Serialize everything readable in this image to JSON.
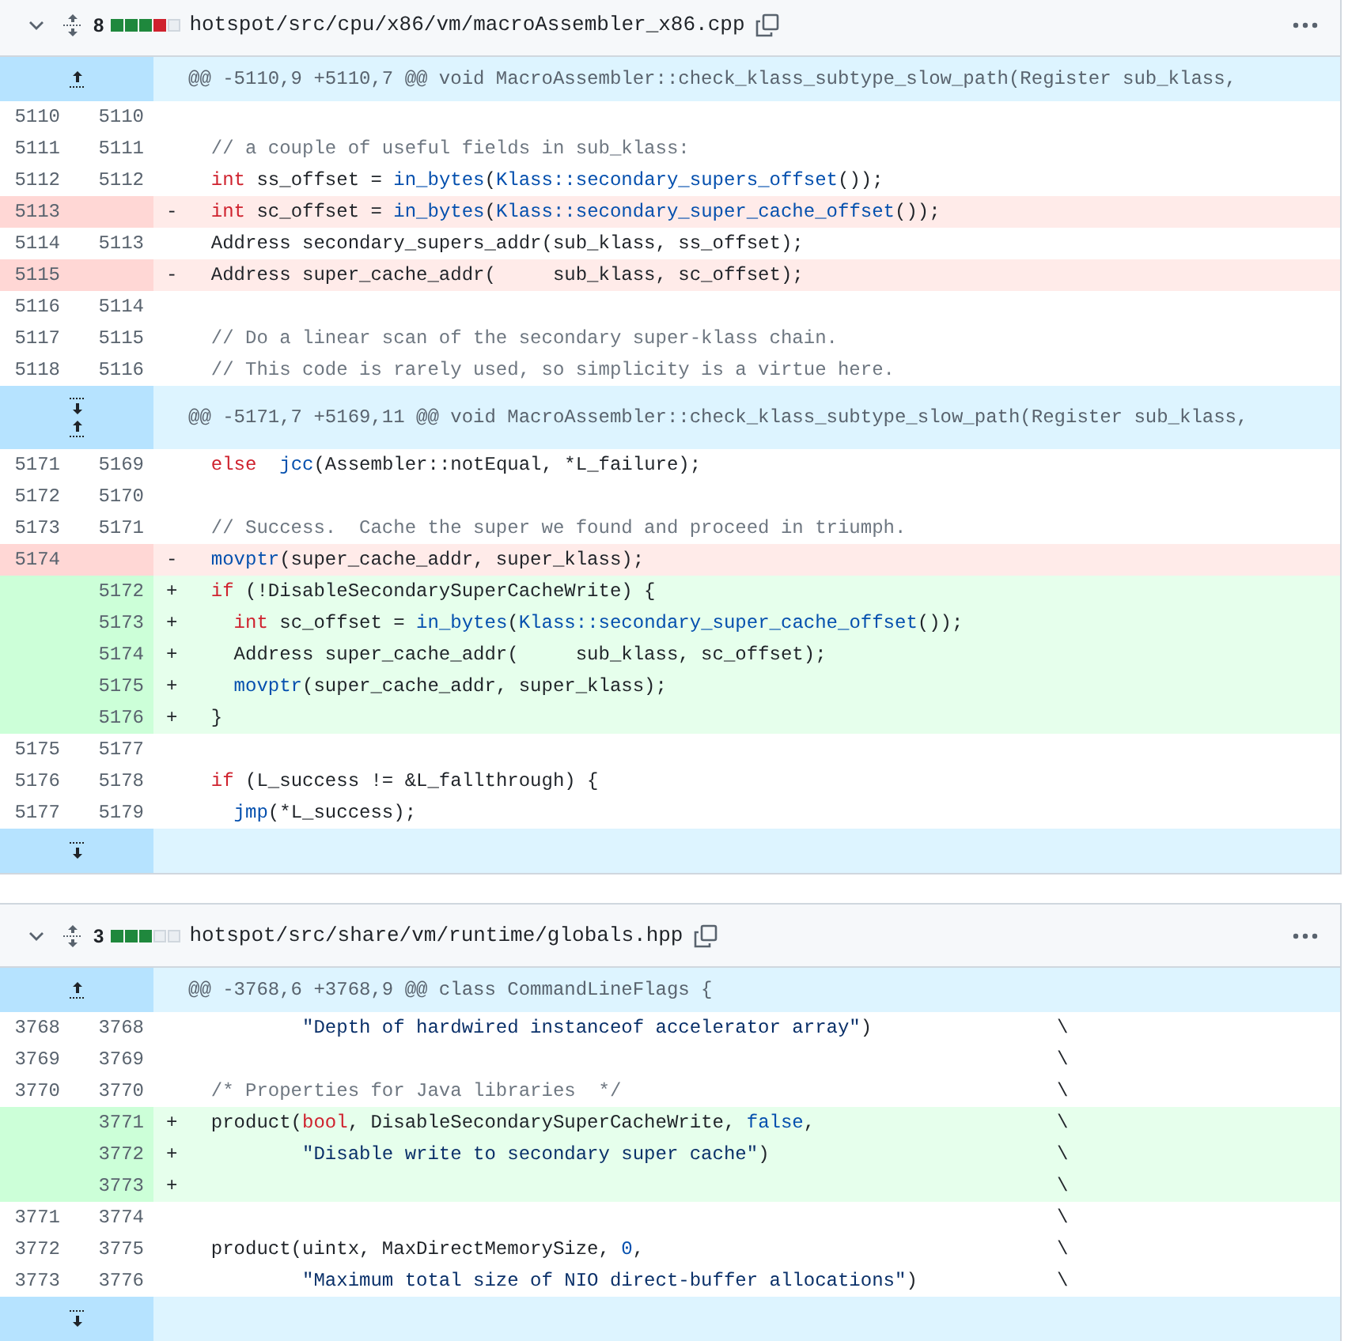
{
  "files": [
    {
      "changes": "8",
      "diffstat": [
        {
          "kind": "added"
        },
        {
          "kind": "added"
        },
        {
          "kind": "added"
        },
        {
          "kind": "deleted"
        },
        {
          "kind": "neutral"
        }
      ],
      "path": "hotspot/src/cpu/x86/vm/macroAssembler_x86.cpp",
      "hunks": [
        {
          "kind": "up",
          "header": "@@ -5110,9 +5110,7 @@ void MacroAssembler::check_klass_subtype_slow_path(Register sub_klass,",
          "lines": [
            {
              "kind": "context",
              "old": "5110",
              "new": "5110"
            },
            {
              "kind": "context",
              "old": "5111",
              "new": "5111",
              "code": [
                {
                  "kind": "comment",
                  "text": "  // a couple of useful fields in sub_klass:"
                }
              ]
            },
            {
              "kind": "context",
              "old": "5112",
              "new": "5112",
              "code": [
                {
                  "kind": "keyword",
                  "text": "  int"
                },
                {
                  "kind": "plain",
                  "text": " ss_offset = "
                },
                {
                  "kind": "entity",
                  "text": "in_bytes"
                },
                {
                  "kind": "plain",
                  "text": "("
                },
                {
                  "kind": "entity",
                  "text": "Klass::secondary_supers_offset"
                },
                {
                  "kind": "plain",
                  "text": "());"
                }
              ]
            },
            {
              "kind": "deletion",
              "old": "5113",
              "sign": "-",
              "code": [
                {
                  "kind": "keyword",
                  "text": "  int"
                },
                {
                  "kind": "plain",
                  "text": " sc_offset = "
                },
                {
                  "kind": "entity",
                  "text": "in_bytes"
                },
                {
                  "kind": "plain",
                  "text": "("
                },
                {
                  "kind": "entity",
                  "text": "Klass::secondary_super_cache_offset"
                },
                {
                  "kind": "plain",
                  "text": "());"
                }
              ]
            },
            {
              "kind": "context",
              "old": "5114",
              "new": "5113",
              "code": [
                {
                  "kind": "plain",
                  "text": "  Address secondary_supers_addr(sub_klass, ss_offset);"
                }
              ]
            },
            {
              "kind": "deletion",
              "old": "5115",
              "sign": "-",
              "code": [
                {
                  "kind": "plain",
                  "text": "  Address super_cache_addr(     sub_klass, sc_offset);"
                }
              ]
            },
            {
              "kind": "context",
              "old": "5116",
              "new": "5114"
            },
            {
              "kind": "context",
              "old": "5117",
              "new": "5115",
              "code": [
                {
                  "kind": "comment",
                  "text": "  // Do a linear scan of the secondary super-klass chain."
                }
              ]
            },
            {
              "kind": "context",
              "old": "5118",
              "new": "5116",
              "code": [
                {
                  "kind": "comment",
                  "text": "  // This code is rarely used, so simplicity is a virtue here."
                }
              ]
            }
          ]
        },
        {
          "kind": "both",
          "header": "@@ -5171,7 +5169,11 @@ void MacroAssembler::check_klass_subtype_slow_path(Register sub_klass,",
          "lines": [
            {
              "kind": "context",
              "old": "5171",
              "new": "5169",
              "code": [
                {
                  "kind": "keyword",
                  "text": "  else"
                },
                {
                  "kind": "entity",
                  "text": "  jcc"
                },
                {
                  "kind": "plain",
                  "text": "(Assembler::notEqual, *L_failure);"
                }
              ]
            },
            {
              "kind": "context",
              "old": "5172",
              "new": "5170"
            },
            {
              "kind": "context",
              "old": "5173",
              "new": "5171",
              "code": [
                {
                  "kind": "comment",
                  "text": "  // Success.  Cache the super we found and proceed in triumph."
                }
              ]
            },
            {
              "kind": "deletion",
              "old": "5174",
              "sign": "-",
              "code": [
                {
                  "kind": "entity",
                  "text": "  movptr"
                },
                {
                  "kind": "plain",
                  "text": "(super_cache_addr, super_klass);"
                }
              ]
            },
            {
              "kind": "addition",
              "new": "5172",
              "sign": "+",
              "code": [
                {
                  "kind": "keyword",
                  "text": "  if"
                },
                {
                  "kind": "plain",
                  "text": " (!DisableSecondarySuperCacheWrite) {"
                }
              ]
            },
            {
              "kind": "addition",
              "new": "5173",
              "sign": "+",
              "code": [
                {
                  "kind": "keyword",
                  "text": "    int"
                },
                {
                  "kind": "plain",
                  "text": " sc_offset = "
                },
                {
                  "kind": "entity",
                  "text": "in_bytes"
                },
                {
                  "kind": "plain",
                  "text": "("
                },
                {
                  "kind": "entity",
                  "text": "Klass::secondary_super_cache_offset"
                },
                {
                  "kind": "plain",
                  "text": "());"
                }
              ]
            },
            {
              "kind": "addition",
              "new": "5174",
              "sign": "+",
              "code": [
                {
                  "kind": "plain",
                  "text": "    Address super_cache_addr(     sub_klass, sc_offset);"
                }
              ]
            },
            {
              "kind": "addition",
              "new": "5175",
              "sign": "+",
              "code": [
                {
                  "kind": "entity",
                  "text": "    movptr"
                },
                {
                  "kind": "plain",
                  "text": "(super_cache_addr, super_klass);"
                }
              ]
            },
            {
              "kind": "addition",
              "new": "5176",
              "sign": "+",
              "code": [
                {
                  "kind": "plain",
                  "text": "  }"
                }
              ]
            },
            {
              "kind": "context",
              "old": "5175",
              "new": "5177"
            },
            {
              "kind": "context",
              "old": "5176",
              "new": "5178",
              "code": [
                {
                  "kind": "keyword",
                  "text": "  if"
                },
                {
                  "kind": "plain",
                  "text": " (L_success != &L_fallthrough) {"
                }
              ]
            },
            {
              "kind": "context",
              "old": "5177",
              "new": "5179",
              "code": [
                {
                  "kind": "entity",
                  "text": "    jmp"
                },
                {
                  "kind": "plain",
                  "text": "(*L_success);"
                }
              ]
            }
          ]
        },
        {
          "kind": "down"
        }
      ]
    },
    {
      "changes": "3",
      "diffstat": [
        {
          "kind": "added"
        },
        {
          "kind": "added"
        },
        {
          "kind": "added"
        },
        {
          "kind": "neutral"
        },
        {
          "kind": "neutral"
        }
      ],
      "path": "hotspot/src/share/vm/runtime/globals.hpp",
      "hunks": [
        {
          "kind": "up",
          "header": "@@ -3768,6 +3768,9 @@ class CommandLineFlags {",
          "lines": [
            {
              "kind": "context",
              "old": "3768",
              "new": "3768",
              "code": [
                {
                  "kind": "string",
                  "text": "          \"Depth of hardwired instanceof accelerator array\""
                },
                {
                  "kind": "plain",
                  "text": ")"
                }
              ],
              "continuation": "\\"
            },
            {
              "kind": "context",
              "old": "3769",
              "new": "3769",
              "continuation": "\\"
            },
            {
              "kind": "context",
              "old": "3770",
              "new": "3770",
              "code": [
                {
                  "kind": "comment",
                  "text": "  /* Properties for Java libraries  */"
                }
              ],
              "continuation": "\\"
            },
            {
              "kind": "addition",
              "new": "3771",
              "sign": "+",
              "code": [
                {
                  "kind": "plain",
                  "text": "  product("
                },
                {
                  "kind": "keyword",
                  "text": "bool"
                },
                {
                  "kind": "plain",
                  "text": ", DisableSecondarySuperCacheWrite, "
                },
                {
                  "kind": "entity",
                  "text": "false"
                },
                {
                  "kind": "plain",
                  "text": ","
                }
              ],
              "continuation": "\\"
            },
            {
              "kind": "addition",
              "new": "3772",
              "sign": "+",
              "code": [
                {
                  "kind": "string",
                  "text": "          \"Disable write to secondary super cache\""
                },
                {
                  "kind": "plain",
                  "text": ")"
                }
              ],
              "continuation": "\\"
            },
            {
              "kind": "addition",
              "new": "3773",
              "sign": "+",
              "continuation": "\\"
            },
            {
              "kind": "context",
              "old": "3771",
              "new": "3774",
              "continuation": "\\"
            },
            {
              "kind": "context",
              "old": "3772",
              "new": "3775",
              "code": [
                {
                  "kind": "plain",
                  "text": "  product(uintx, MaxDirectMemorySize, "
                },
                {
                  "kind": "entity",
                  "text": "0"
                },
                {
                  "kind": "plain",
                  "text": ","
                }
              ],
              "continuation": "\\"
            },
            {
              "kind": "context",
              "old": "3773",
              "new": "3776",
              "code": [
                {
                  "kind": "string",
                  "text": "          \"Maximum total size of NIO direct-buffer allocations\""
                },
                {
                  "kind": "plain",
                  "text": ")"
                }
              ],
              "continuation": "\\"
            }
          ]
        },
        {
          "kind": "down"
        }
      ]
    }
  ]
}
